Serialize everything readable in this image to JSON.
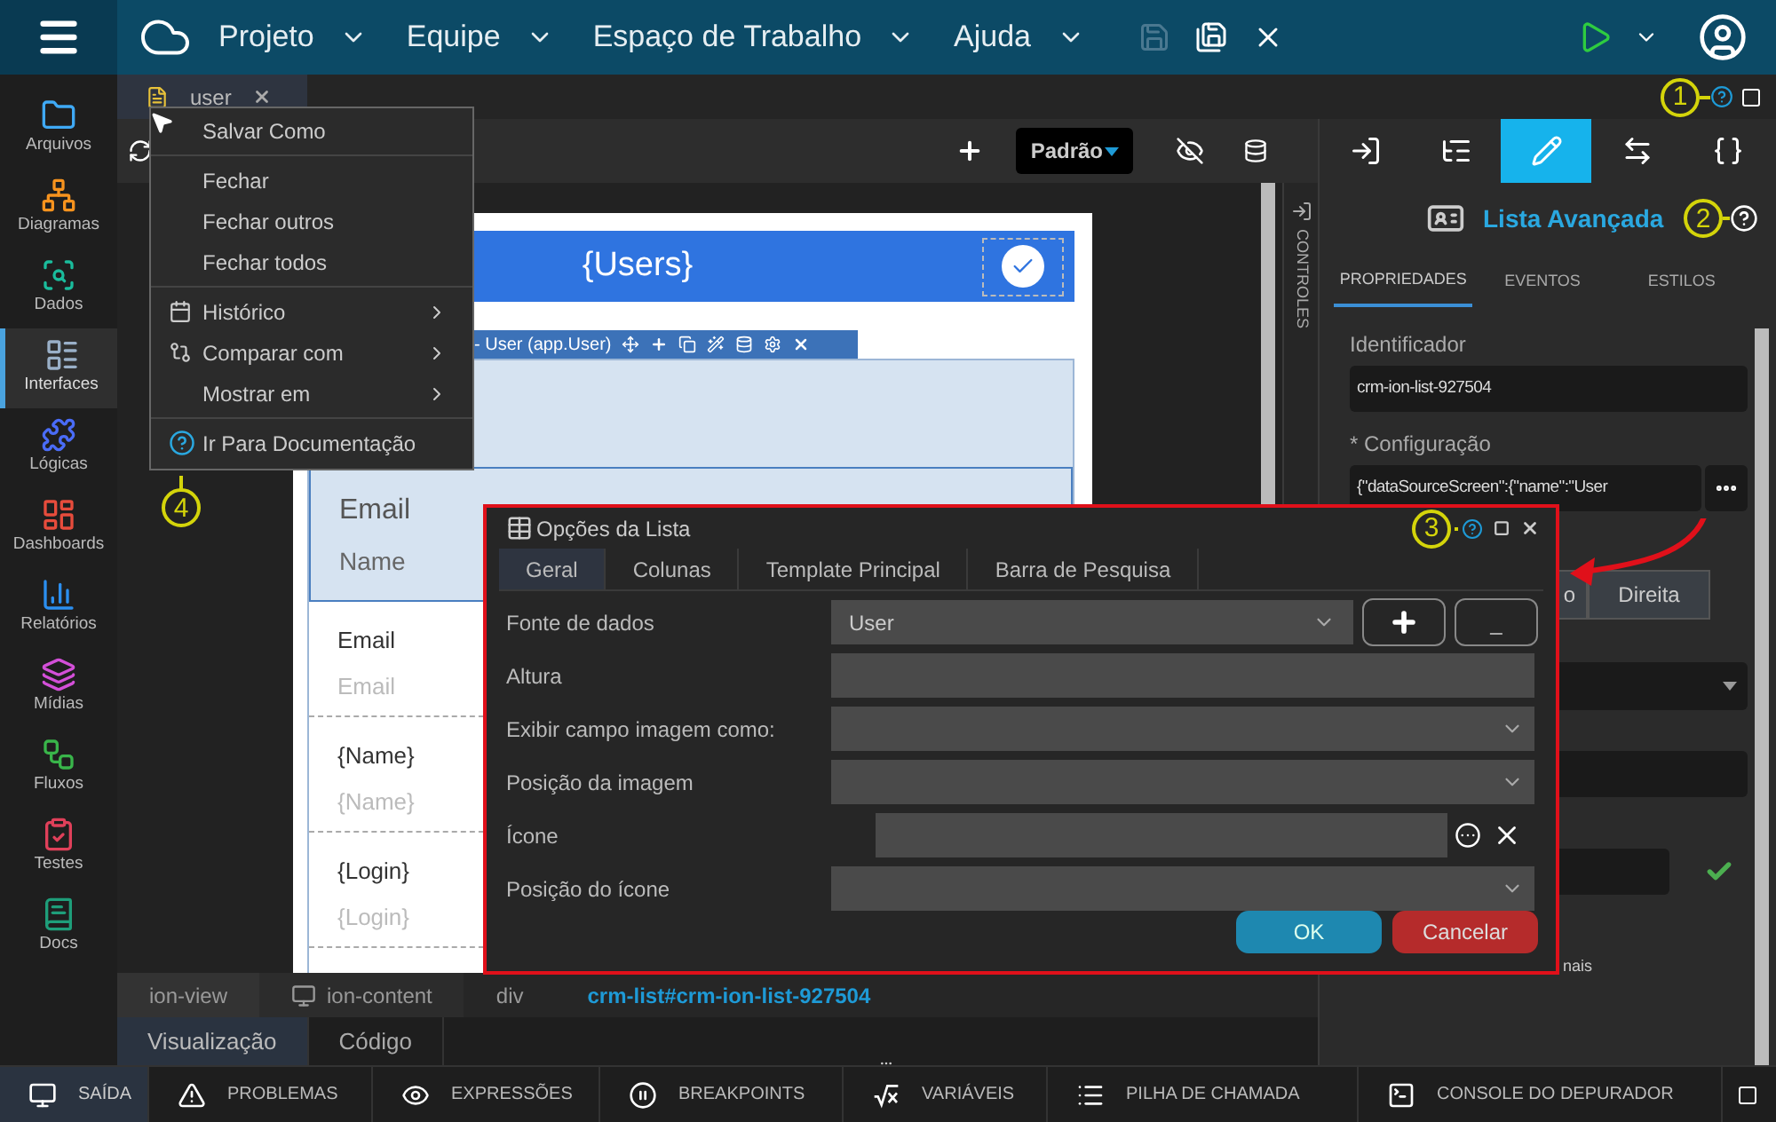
{
  "top_bar": {
    "menus": [
      {
        "label": "Projeto"
      },
      {
        "label": "Equipe"
      },
      {
        "label": "Espaço de Trabalho"
      },
      {
        "label": "Ajuda"
      }
    ],
    "actions": [
      {
        "disabled": true
      },
      {
        "disabled": false
      },
      {
        "disabled": false
      }
    ]
  },
  "sidebar": {
    "items": [
      {
        "label": "Arquivos",
        "color": "#3fa9f5",
        "selected": false
      },
      {
        "label": "Diagramas",
        "color": "#f7931e",
        "selected": false
      },
      {
        "label": "Dados",
        "color": "#1abc9c",
        "selected": false
      },
      {
        "label": "Interfaces",
        "color": "#9ab0c8",
        "selected": true
      },
      {
        "label": "Lógicas",
        "color": "#4a6cf7",
        "selected": false
      },
      {
        "label": "Dashboards",
        "color": "#e74c3c",
        "selected": false
      },
      {
        "label": "Relatórios",
        "color": "#2b8ff0",
        "selected": false
      },
      {
        "label": "Mídias",
        "color": "#d34fd8",
        "selected": false
      },
      {
        "label": "Fluxos",
        "color": "#39b54a",
        "selected": false
      },
      {
        "label": "Testes",
        "color": "#e0405a",
        "selected": false
      },
      {
        "label": "Docs",
        "color": "#1e9e7a",
        "selected": false
      }
    ]
  },
  "file_tabs": [
    {
      "label": "user",
      "selected": true
    }
  ],
  "context_menu": {
    "groups": [
      [
        {
          "label": "Salvar Como",
          "submenu": false
        }
      ],
      [
        {
          "label": "Fechar",
          "submenu": false
        },
        {
          "label": "Fechar outros",
          "submenu": false
        },
        {
          "label": "Fechar todos",
          "submenu": false
        }
      ],
      [
        {
          "label": "Histórico",
          "submenu": true
        },
        {
          "label": "Comparar com",
          "submenu": true
        },
        {
          "label": "Mostrar em",
          "submenu": true
        }
      ],
      [
        {
          "label": "Ir Para Documentação",
          "submenu": false
        }
      ]
    ]
  },
  "editor_toolbar": {
    "mode": "Padrão"
  },
  "controls_strip": {
    "label": "CONTROLES"
  },
  "canvas": {
    "header_title": "{Users}",
    "component_label": "- User (app.User)",
    "list_items": [
      {
        "title": "Email",
        "subtitle": "Name",
        "selected": true
      },
      {
        "title": "Email",
        "subtitle": "Email",
        "selected": false
      },
      {
        "title": "{Name}",
        "subtitle": "{Name}",
        "selected": false
      },
      {
        "title": "{Login}",
        "subtitle": "{Login}",
        "selected": false
      }
    ]
  },
  "breadcrumb": [
    {
      "label": "ion-view"
    },
    {
      "label": "ion-content"
    },
    {
      "label": "div"
    },
    {
      "label": "crm-list#crm-ion-list-927504"
    }
  ],
  "view_tabs": [
    {
      "label": "Visualização",
      "selected": true
    },
    {
      "label": "Código",
      "selected": false
    }
  ],
  "properties_panel": {
    "tabs": [
      {
        "selected": false
      },
      {
        "selected": false
      },
      {
        "selected": true
      },
      {
        "selected": false
      },
      {
        "selected": false
      }
    ],
    "component": "Lista Avançada",
    "subtabs": [
      {
        "label": "PROPRIEDADES",
        "selected": true
      },
      {
        "label": "EVENTOS",
        "selected": false
      },
      {
        "label": "ESTILOS",
        "selected": false
      }
    ],
    "fields": [
      {
        "label": "Identificador",
        "value": "crm-ion-list-927504"
      },
      {
        "label": "* Configuração",
        "value": "{\"dataSourceScreen\":{\"name\":\"User"
      }
    ],
    "segments": [
      {
        "label": "o"
      },
      {
        "label": "Direita"
      }
    ],
    "note": "nais"
  },
  "dialog": {
    "title": "Opções da Lista",
    "tabs": [
      {
        "label": "Geral",
        "selected": true
      },
      {
        "label": "Colunas",
        "selected": false
      },
      {
        "label": "Template Principal",
        "selected": false
      },
      {
        "label": "Barra de Pesquisa",
        "selected": false
      }
    ],
    "fields": [
      {
        "label": "Fonte de dados",
        "kind": "source",
        "value": "User",
        "remove_label": "_"
      },
      {
        "label": "Altura",
        "kind": "text"
      },
      {
        "label": "Exibir campo imagem como:",
        "kind": "select"
      },
      {
        "label": "Posição da imagem",
        "kind": "select"
      },
      {
        "label": "Ícone",
        "kind": "icon"
      },
      {
        "label": "Posição do ícone",
        "kind": "select"
      }
    ],
    "buttons": [
      {
        "label": "OK",
        "kind": "primary"
      },
      {
        "label": "Cancelar",
        "kind": "danger"
      }
    ]
  },
  "bottom_tabs": [
    {
      "label": "SAÍDA",
      "selected": true
    },
    {
      "label": "PROBLEMAS",
      "selected": false
    },
    {
      "label": "EXPRESSÕES",
      "selected": false
    },
    {
      "label": "BREAKPOINTS",
      "selected": false
    },
    {
      "label": "VARIÁVEIS",
      "selected": false
    },
    {
      "label": "PILHA DE CHAMADA",
      "selected": false
    },
    {
      "label": "CONSOLE DO DEPURADOR",
      "selected": false
    }
  ],
  "annotations": [
    {
      "number": "1"
    },
    {
      "number": "2"
    },
    {
      "number": "3"
    },
    {
      "number": "4"
    }
  ]
}
